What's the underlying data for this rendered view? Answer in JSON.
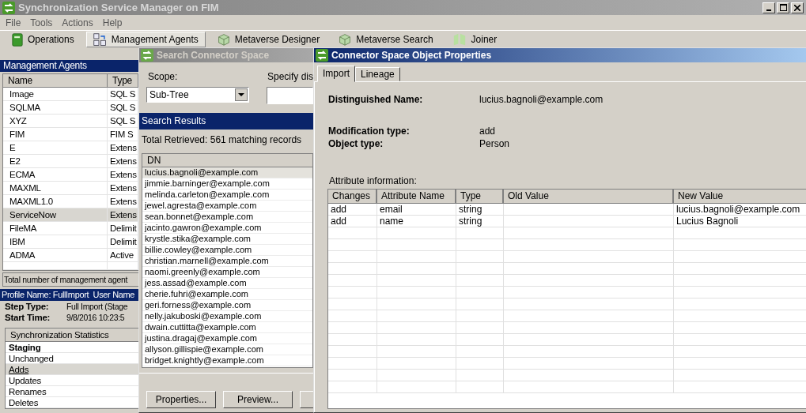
{
  "window": {
    "title": "Synchronization Service Manager on FIM"
  },
  "menu": [
    "File",
    "Tools",
    "Actions",
    "Help"
  ],
  "toolbar": [
    {
      "label": "Operations",
      "selected": false
    },
    {
      "label": "Management Agents",
      "selected": true
    },
    {
      "label": "Metaverse Designer",
      "selected": false
    },
    {
      "label": "Metaverse Search",
      "selected": false
    },
    {
      "label": "Joiner",
      "selected": false
    }
  ],
  "management_agents": {
    "title": "Management Agents",
    "columns": [
      "Name",
      "Type"
    ],
    "rows": [
      {
        "name": "Image",
        "type": "SQL S",
        "selected": false
      },
      {
        "name": "SQLMA",
        "type": "SQL S",
        "selected": false
      },
      {
        "name": "XYZ",
        "type": "SQL S",
        "selected": false
      },
      {
        "name": "FIM",
        "type": "FIM S",
        "selected": false
      },
      {
        "name": "E",
        "type": "Extens",
        "selected": false
      },
      {
        "name": "E2",
        "type": "Extens",
        "selected": false
      },
      {
        "name": "ECMA",
        "type": "Extens",
        "selected": false
      },
      {
        "name": "MAXML",
        "type": "Extens",
        "selected": false
      },
      {
        "name": "MAXML1.0",
        "type": "Extens",
        "selected": false
      },
      {
        "name": "ServiceNow",
        "type": "Extens",
        "selected": true
      },
      {
        "name": "FileMA",
        "type": "Delimit",
        "selected": false
      },
      {
        "name": "IBM",
        "type": "Delimit",
        "selected": false
      },
      {
        "name": "ADMA",
        "type": "Active",
        "selected": false
      }
    ],
    "status": "Total number of management agent"
  },
  "run_profile": {
    "header": "Profile Name: FullImport  User Name",
    "fields": [
      {
        "label": "Step Type:",
        "value": "Full Import (Stage"
      },
      {
        "label": "Start Time:",
        "value": "9/8/2016 10:23:5"
      }
    ],
    "stats_title": "Synchronization Statistics",
    "stats": [
      {
        "label": "Staging",
        "kind": "header",
        "selected": false
      },
      {
        "label": "Unchanged",
        "kind": "item",
        "selected": false
      },
      {
        "label": "Adds",
        "kind": "item",
        "selected": true
      },
      {
        "label": "Updates",
        "kind": "item",
        "selected": false
      },
      {
        "label": "Renames",
        "kind": "item",
        "selected": false
      },
      {
        "label": "Deletes",
        "kind": "item",
        "selected": false
      }
    ]
  },
  "search_dialog": {
    "title": "Search Connector Space",
    "scope_label": "Scope:",
    "scope_value": "Sub-Tree",
    "dn_label": "Specify dis",
    "results_title": "Search Results",
    "total": "Total Retrieved: 561 matching records",
    "column": "DN",
    "rows": [
      {
        "dn": "lucius.bagnoli@example.com",
        "selected": true
      },
      {
        "dn": "jimmie.barninger@example.com",
        "selected": false
      },
      {
        "dn": "melinda.carleton@example.com",
        "selected": false
      },
      {
        "dn": "jewel.agresta@example.com",
        "selected": false
      },
      {
        "dn": "sean.bonnet@example.com",
        "selected": false
      },
      {
        "dn": "jacinto.gawron@example.com",
        "selected": false
      },
      {
        "dn": "krystle.stika@example.com",
        "selected": false
      },
      {
        "dn": "billie.cowley@example.com",
        "selected": false
      },
      {
        "dn": "christian.marnell@example.com",
        "selected": false
      },
      {
        "dn": "naomi.greenly@example.com",
        "selected": false
      },
      {
        "dn": "jess.assad@example.com",
        "selected": false
      },
      {
        "dn": "cherie.fuhri@example.com",
        "selected": false
      },
      {
        "dn": "geri.forness@example.com",
        "selected": false
      },
      {
        "dn": "nelly.jakuboski@example.com",
        "selected": false
      },
      {
        "dn": "dwain.cuttitta@example.com",
        "selected": false
      },
      {
        "dn": "justina.dragaj@example.com",
        "selected": false
      },
      {
        "dn": "allyson.gillispie@example.com",
        "selected": false
      },
      {
        "dn": "bridget.knightly@example.com",
        "selected": false
      }
    ],
    "buttons": [
      "Properties...",
      "Preview..."
    ]
  },
  "properties_dialog": {
    "title": "Connector Space Object Properties",
    "tabs": [
      {
        "label": "Import",
        "selected": true
      },
      {
        "label": "Lineage",
        "selected": false
      }
    ],
    "field_groups": [
      [
        {
          "label": "Distinguished Name:",
          "value": "lucius.bagnoli@example.com"
        }
      ],
      [
        {
          "label": "Modification type:",
          "value": "add"
        },
        {
          "label": "Object type:",
          "value": "Person"
        }
      ]
    ],
    "attribute_title": "Attribute information:",
    "columns": [
      "Changes",
      "Attribute Name",
      "Type",
      "Old Value",
      "New Value"
    ],
    "rows": [
      [
        "add",
        "email",
        "string",
        "",
        "lucius.bagnoli@example.com"
      ],
      [
        "add",
        "name",
        "string",
        "",
        "Lucius Bagnoli"
      ]
    ]
  }
}
